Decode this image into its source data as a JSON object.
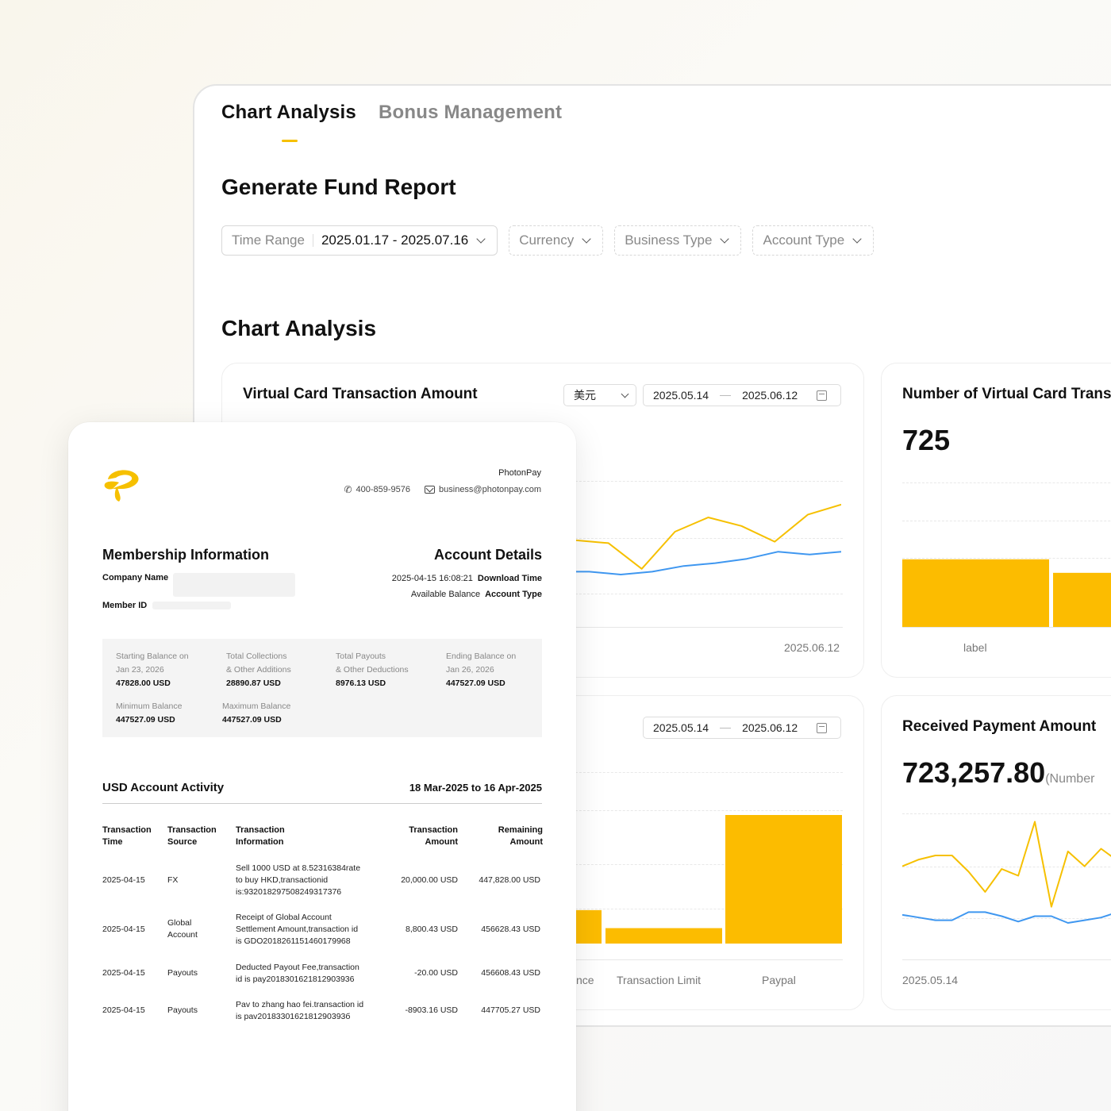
{
  "tabs": [
    {
      "label": "Chart Analysis",
      "active": true
    },
    {
      "label": "Bonus Management",
      "active": false
    }
  ],
  "report": {
    "title": "Generate Fund Report",
    "filters": {
      "time_range_label": "Time Range",
      "time_range_value": "2025.01.17 - 2025.07.16",
      "currency": "Currency",
      "business_type": "Business Type",
      "account_type": "Account Type"
    }
  },
  "chart_section_title": "Chart Analysis",
  "cards": {
    "vc_amount": {
      "title": "Virtual Card Transaction Amount",
      "currency": "美元",
      "date_start": "2025.05.14",
      "date_end": "2025.06.12",
      "x_label_end": "2025.06.12"
    },
    "vc_count": {
      "title": "Number of Virtual Card Trans",
      "value": "725",
      "bar_label": "label"
    },
    "bar_card": {
      "date_start": "2025.05.14",
      "date_end": "2025.06.12",
      "labels": [
        "nce",
        "Transaction Limit",
        "Paypal"
      ]
    },
    "received": {
      "title": "Received Payment Amount",
      "value": "723,257.80",
      "unit": "(Number",
      "x_label_start": "2025.05.14"
    }
  },
  "chart_data": [
    {
      "type": "line",
      "title": "Virtual Card Transaction Amount",
      "series": [
        {
          "values": [
            0.62,
            0.55,
            0.1,
            0.65,
            0.62,
            0.92,
            0.56,
            0.55,
            0.5,
            0.54,
            0.54,
            0.52,
            0.34,
            0.6,
            0.7,
            0.64,
            0.53,
            0.72,
            0.79
          ],
          "color": "#f6c000"
        },
        {
          "values": [
            0.37,
            0.36,
            0.38,
            0.42,
            0.4,
            0.38,
            0.37,
            0.33,
            0.33,
            0.3,
            0.32,
            0.32,
            0.3,
            0.32,
            0.36,
            0.38,
            0.41,
            0.46,
            0.44,
            0.46
          ],
          "color": "#3f97f0"
        }
      ]
    },
    {
      "type": "bar",
      "title": "Number of Virtual Card Trans",
      "categories": [
        "label",
        ""
      ],
      "values": [
        0.6,
        0.48
      ],
      "color": "#fcbc00"
    },
    {
      "type": "bar",
      "categories": [
        "nce",
        "Transaction Limit",
        "Paypal"
      ],
      "values": [
        0.26,
        0.12,
        1.0
      ],
      "color": "#fcbc00"
    },
    {
      "type": "line",
      "title": "Received Payment Amount",
      "series": [
        {
          "values": [
            0.62,
            0.67,
            0.7,
            0.7,
            0.58,
            0.43,
            0.6,
            0.55,
            0.95,
            0.32,
            0.73,
            0.62,
            0.75,
            0.66,
            0.47,
            0.68,
            0.75
          ],
          "color": "#f6c000"
        },
        {
          "values": [
            0.26,
            0.24,
            0.22,
            0.22,
            0.28,
            0.28,
            0.25,
            0.21,
            0.25,
            0.25,
            0.2,
            0.22,
            0.24,
            0.28,
            0.25,
            0.27,
            0.28
          ],
          "color": "#3f97f0"
        }
      ]
    }
  ],
  "statement": {
    "company": "PhotonPay",
    "phone": "400-859-9576",
    "email": "business@photonpay.com",
    "membership_title": "Membership Information",
    "company_name_label": "Company Name",
    "member_id_label": "Member ID",
    "account_details_title": "Account Details",
    "download_time_value": "2025-04-15 16:08:21",
    "download_time_label": "Download Time",
    "account_type_value": "Available Balance",
    "account_type_label": "Account Type",
    "summary": [
      {
        "label1": "Starting Balance on",
        "label2": "Jan 23, 2026",
        "value": "47828.00 USD"
      },
      {
        "label1": "Total Collections",
        "label2": "& Other Additions",
        "value": "28890.87 USD"
      },
      {
        "label1": "Total Payouts",
        "label2": "& Other Deductions",
        "value": "8976.13 USD"
      },
      {
        "label1": "Ending Balance on",
        "label2": "Jan 26, 2026",
        "value": "447527.09 USD"
      },
      {
        "label1": "Minimum Balance",
        "label2": "",
        "value": "447527.09 USD"
      },
      {
        "label1": "Maximum Balance",
        "label2": "",
        "value": "447527.09 USD"
      }
    ],
    "activity_title": "USD Account Activity",
    "activity_range": "18 Mar-2025 to 16 Apr-2025",
    "columns": [
      {
        "l1": "Transaction",
        "l2": "Time"
      },
      {
        "l1": "Transaction",
        "l2": "Source"
      },
      {
        "l1": "Transaction",
        "l2": "Information"
      },
      {
        "l1": "Transaction",
        "l2": "Amount"
      },
      {
        "l1": "Remaining",
        "l2": "Amount"
      }
    ],
    "rows": [
      {
        "time": "2025-04-15",
        "source1": "FX",
        "source2": "",
        "info1": "Sell 1000 USD at 8.52316384rate",
        "info2": "to buy HKD,transactionid",
        "info3": "is:932018297508249317376",
        "amount": "20,000.00 USD",
        "remaining": "447,828.00 USD"
      },
      {
        "time": "2025-04-15",
        "source1": "Global",
        "source2": "Account",
        "info1": "Receipt of Global Account",
        "info2": "Settlement Amount,transaction id",
        "info3": "is GDO2018261151460179968",
        "amount": "8,800.43 USD",
        "remaining": "456628.43 USD"
      },
      {
        "time": "2025-04-15",
        "source1": "Payouts",
        "source2": "",
        "info1": "Deducted Payout Fee,transaction",
        "info2": "id is pay2018301621812903936",
        "info3": "",
        "amount": "-20.00 USD",
        "remaining": "456608.43 USD"
      },
      {
        "time": "2025-04-15",
        "source1": "Payouts",
        "source2": "",
        "info1": "Pav to zhang hao fei.transaction id",
        "info2": "is pav2018330162181290393б",
        "info3": "",
        "amount": "-8903.16 USD",
        "remaining": "447705.27 USD"
      }
    ]
  }
}
